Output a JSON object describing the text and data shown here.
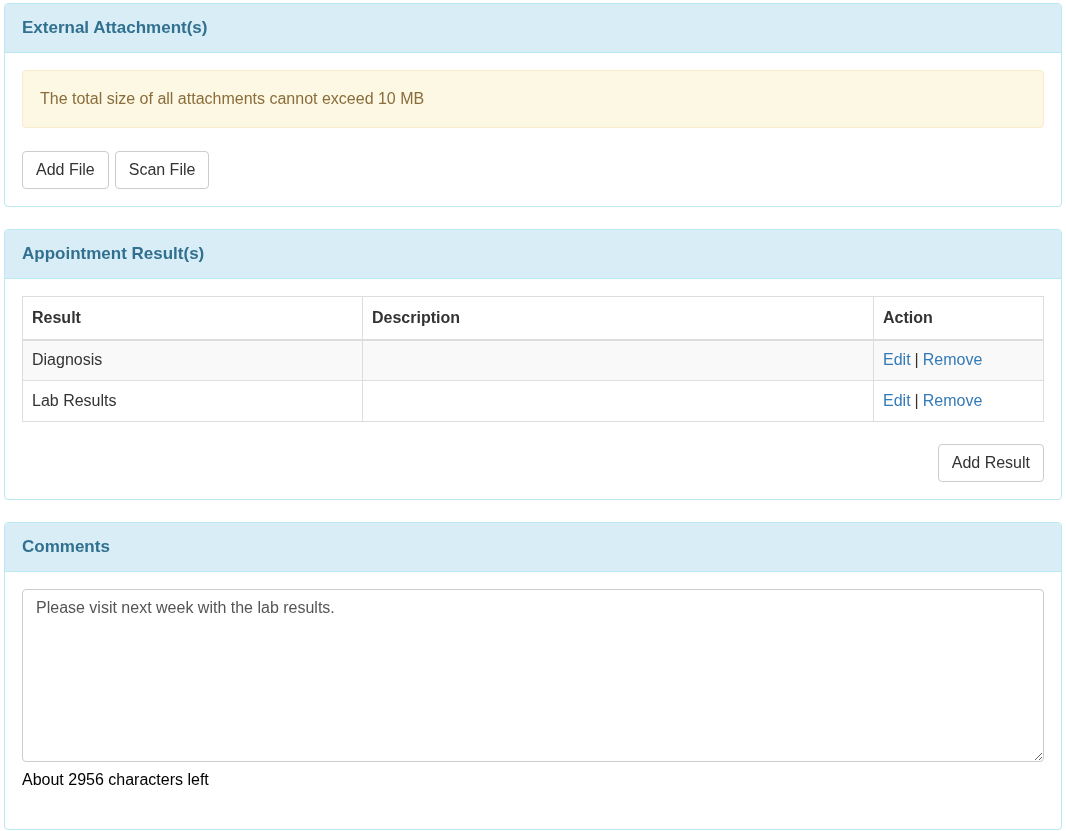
{
  "attachments": {
    "title": "External Attachment(s)",
    "alert": "The total size of all attachments cannot exceed 10 MB",
    "buttons": [
      "Add File",
      "Scan File"
    ]
  },
  "results": {
    "title": "Appointment Result(s)",
    "columns": [
      "Result",
      "Description",
      "Action"
    ],
    "rows": [
      {
        "result": "Diagnosis",
        "actions": [
          "Edit",
          "Remove"
        ],
        "separator": "|"
      },
      {
        "result": "Lab Results",
        "actions": [
          "Edit",
          "Remove"
        ],
        "separator": "|"
      }
    ],
    "add_button": "Add Result"
  },
  "comments": {
    "title": "Comments",
    "value": "Please visit next week with the lab results.",
    "counter": "About 2956 characters left"
  }
}
